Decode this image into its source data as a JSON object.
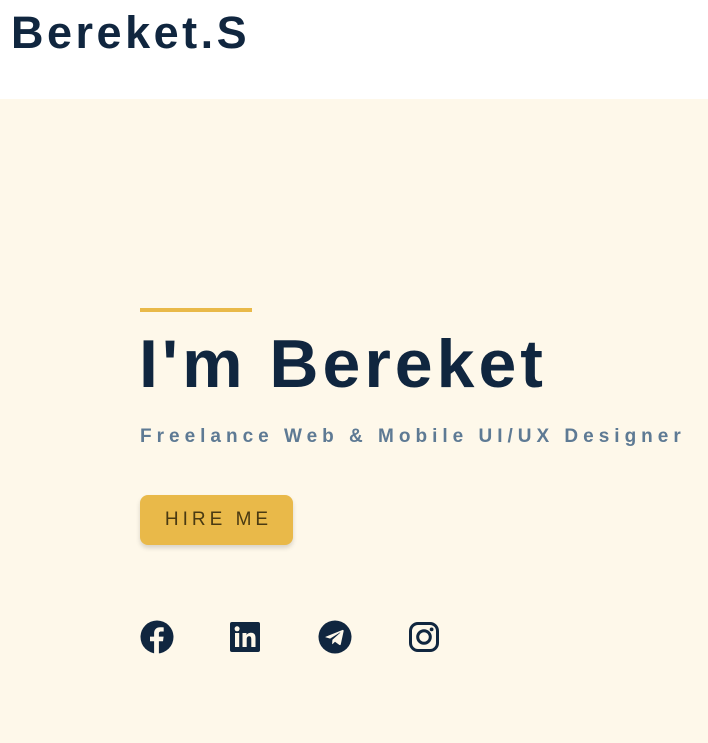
{
  "header": {
    "logo": "Bereket.S"
  },
  "hero": {
    "title": "I'm Bereket",
    "subtitle": "Freelance Web & Mobile UI/UX Designer",
    "cta_label": "HIRE ME"
  },
  "socials": [
    {
      "icon": "facebook-icon"
    },
    {
      "icon": "linkedin-icon"
    },
    {
      "icon": "telegram-icon"
    },
    {
      "icon": "instagram-icon"
    }
  ],
  "colors": {
    "navy": "#10263f",
    "accent": "#e9b949",
    "hero_bg": "#fef8ea",
    "subtitle": "#5e7a94"
  }
}
